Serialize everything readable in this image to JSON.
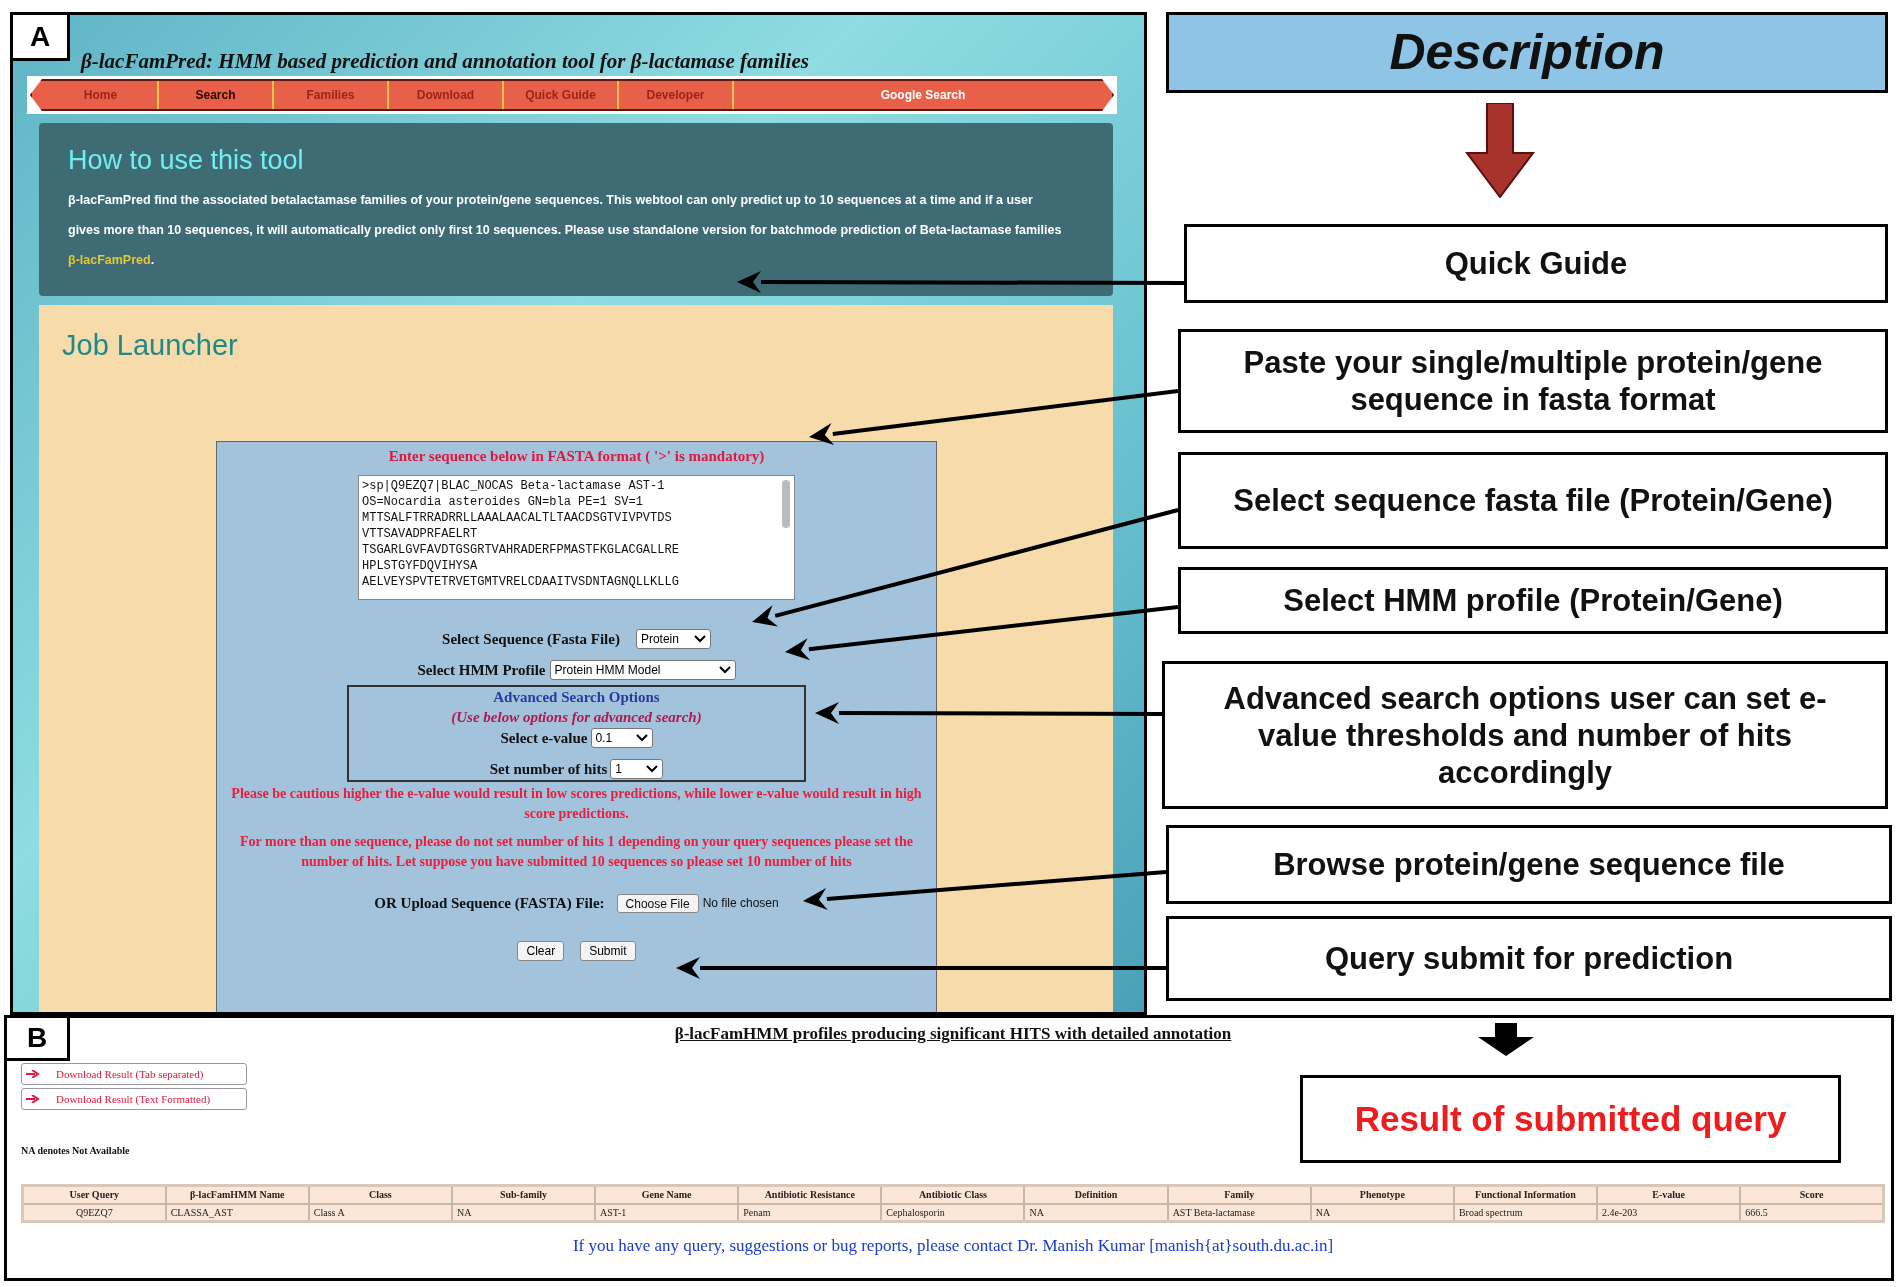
{
  "panel_a": {
    "label": "A",
    "site_title": "β-lacFamPred: HMM based prediction and annotation tool for β-lactamase families",
    "nav": [
      {
        "label": "Home",
        "selected": false
      },
      {
        "label": "Search",
        "selected": true
      },
      {
        "label": "Families",
        "selected": false
      },
      {
        "label": "Download",
        "selected": false
      },
      {
        "label": "Quick Guide",
        "selected": false
      },
      {
        "label": "Developer",
        "selected": false
      }
    ],
    "nav_search": "Google Search",
    "how_to": {
      "heading": "How to use this tool",
      "text": "β-lacFamPred find the associated betalactamase families of your protein/gene sequences. This webtool can only predict up to 10 sequences at a time and if a user gives more than 10 sequences, it will automatically predict only first 10 sequences. Please use standalone version for batchmode prediction of Beta-lactamase families ",
      "link": "β-lacFamPred",
      "end": "."
    },
    "job_launcher": {
      "heading": "Job Launcher",
      "fasta_prompt": "Enter sequence below in FASTA format ( '>' is mandatory)",
      "sequence_lines": [
        ">sp|Q9EZQ7|BLAC_NOCAS Beta-lactamase AST-1",
        "OS=Nocardia asteroides GN=bla PE=1 SV=1",
        "MTTSALFTRRADRRLLAAALAACALTLTAACDSGTVIVPVTDS",
        "VTTSAVADPRFAELRT",
        "TSGARLGVFAVDTGSGRTVAHRADERFPMASTFKGLACGALLRE",
        "HPLSTGYFDQVIHYSA",
        "AELVEYSPVTETRVETGMTVRELCDAAITVSDNTAGNQLLKLLG"
      ],
      "sequence_select": {
        "label": "Select Sequence (Fasta File)",
        "value": "Protein"
      },
      "hmm_select": {
        "label": "Select HMM Profile",
        "value": "Protein HMM Model"
      },
      "advanced": {
        "title": "Advanced Search Options",
        "subtitle": "(Use below options for advanced search)",
        "evalue": {
          "label": "Select e-value",
          "value": "0.1"
        },
        "hits": {
          "label": "Set number of hits",
          "value": "1"
        }
      },
      "warnings": [
        "Please be cautious higher the e-value would result in low scores predictions, while lower e-value would result in high score predictions.",
        "For more than one sequence, please do not set number of hits 1 depending on your query sequences please set the number of hits. Let suppose you have submitted 10 sequences so please set 10 number of hits"
      ],
      "upload": {
        "label": "OR Upload Sequence (FASTA) File:",
        "button": "Choose File",
        "status": "No file chosen"
      },
      "buttons": [
        "Clear",
        "Submit"
      ]
    }
  },
  "description": {
    "title": "Description",
    "callouts": [
      "Quick Guide",
      "Paste your single/multiple protein/gene sequence in fasta format",
      "Select sequence fasta file (Protein/Gene)",
      "Select HMM profile (Protein/Gene)",
      "Advanced search options user can set e-value thresholds and number of hits accordingly",
      "Browse protein/gene sequence file",
      "Query submit for prediction"
    ]
  },
  "panel_b": {
    "label": "B",
    "title": "β-lacFamHMM profiles producing significant HITS with detailed annotation",
    "downloads": [
      "Download Result (Tab separated)",
      "Download Result (Text Formatted)"
    ],
    "note": "NA denotes Not Available",
    "result_callout": "Result of submitted query",
    "table": {
      "columns": [
        "User Query",
        "β-lacFamHMM Name",
        "Class",
        "Sub-family",
        "Gene Name",
        "Antibiotic Resistance",
        "Antibiotic Class",
        "Definition",
        "Family",
        "Phenotype",
        "Functional Information",
        "E-value",
        "Score"
      ],
      "rows": [
        [
          "Q9EZQ7",
          "CLASSA_AST",
          "Class A",
          "NA",
          "AST-1",
          "Penam",
          "Cephalosporin",
          "NA",
          "AST Beta-lactamase",
          "NA",
          "Broad spectrum",
          "2.4e-203",
          "666.5"
        ]
      ]
    },
    "contact": "If you have any query, suggestions or bug reports, please contact Dr. Manish Kumar [manish{at}south.du.ac.in]"
  }
}
